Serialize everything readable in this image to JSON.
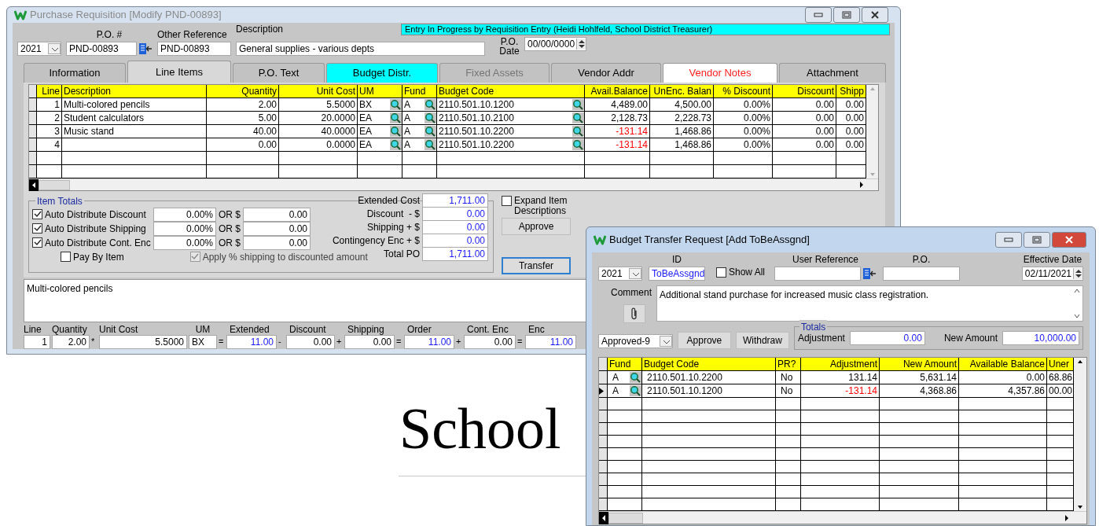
{
  "background": {
    "heading": "School"
  },
  "requisition_window": {
    "title": "Purchase Requisition [Modify PND-00893]",
    "status_banner": "Entry In Progress by Requisition Entry (Heidi Hohlfeld, School District Treasurer)",
    "year": "2021",
    "po_number": {
      "label": "P.O. #",
      "value": "PND-00893"
    },
    "other_reference": {
      "label": "Other Reference",
      "value": "PND-00893"
    },
    "description": {
      "label": "Description",
      "value": "General supplies - various depts"
    },
    "po_date": {
      "label": "P.O. Date",
      "value": "00/00/0000"
    },
    "tabs": [
      {
        "label": "Information",
        "selected": false,
        "disabled": false,
        "kind": "plain"
      },
      {
        "label": "Line Items",
        "selected": true,
        "disabled": false,
        "kind": "plain"
      },
      {
        "label": "P.O. Text",
        "selected": false,
        "disabled": false,
        "kind": "plain"
      },
      {
        "label": "Budget Distr.",
        "selected": false,
        "disabled": false,
        "kind": "highlighted"
      },
      {
        "label": "Fixed Assets",
        "selected": false,
        "disabled": true,
        "kind": "plain"
      },
      {
        "label": "Vendor Addr",
        "selected": false,
        "disabled": false,
        "kind": "plain"
      },
      {
        "label": "Vendor Notes",
        "selected": false,
        "disabled": false,
        "kind": "flagged"
      },
      {
        "label": "Attachment",
        "selected": false,
        "disabled": false,
        "kind": "plain"
      }
    ],
    "line_items": {
      "columns": [
        "Line",
        "Description",
        "Quantity",
        "Unit Cost",
        "UM",
        "Fund",
        "Budget Code",
        "Avail.Balance",
        "UnEnc. Balan",
        "% Discount",
        "Discount",
        "Shipp"
      ],
      "rows": [
        {
          "line": "1",
          "description": "Multi-colored pencils",
          "quantity": "2.00",
          "unit_cost": "5.5000",
          "um": "BX",
          "fund": "A",
          "budget_code": "2110.501.10.1200",
          "avail_balance": {
            "value": "4,489.00",
            "negative": false
          },
          "unenc_balance": "4,500.00",
          "pct_discount": "0.00%",
          "discount": "0.00",
          "shipping": "0.00"
        },
        {
          "line": "2",
          "description": "Student calculators",
          "quantity": "5.00",
          "unit_cost": "20.0000",
          "um": "EA",
          "fund": "A",
          "budget_code": "2110.501.10.2100",
          "avail_balance": {
            "value": "2,128.73",
            "negative": false
          },
          "unenc_balance": "2,228.73",
          "pct_discount": "0.00%",
          "discount": "0.00",
          "shipping": "0.00"
        },
        {
          "line": "3",
          "description": "Music stand",
          "quantity": "40.00",
          "unit_cost": "40.0000",
          "um": "EA",
          "fund": "A",
          "budget_code": "2110.501.10.2200",
          "avail_balance": {
            "value": "-131.14",
            "negative": true
          },
          "unenc_balance": "1,468.86",
          "pct_discount": "0.00%",
          "discount": "0.00",
          "shipping": "0.00"
        },
        {
          "line": "4",
          "quantity": "0.00",
          "unit_cost": "0.0000",
          "um": "EA",
          "fund": "A",
          "budget_code": "2110.501.10.2200",
          "avail_balance": {
            "value": "-131.14",
            "negative": true
          },
          "unenc_balance": "1,468.86",
          "pct_discount": "0.00%",
          "discount": "0.00",
          "shipping": "0.00"
        }
      ]
    },
    "item_totals": {
      "title": "Item Totals",
      "options": [
        {
          "label": "Auto Distribute Discount",
          "checked": true,
          "percent": "0.00%",
          "or_label": "OR $",
          "amount": "0.00"
        },
        {
          "label": "Auto Distribute Shipping",
          "checked": true,
          "percent": "0.00%",
          "or_label": "OR $",
          "amount": "0.00"
        },
        {
          "label": "Auto Distribute Cont. Enc",
          "checked": true,
          "percent": "0.00%",
          "or_label": "OR $",
          "amount": "0.00"
        }
      ],
      "pay_by_item": {
        "label": "Pay By Item",
        "checked": false
      },
      "apply_shipping": {
        "label": "Apply % shipping to discounted amount",
        "checked": true,
        "disabled": true
      },
      "totals": [
        {
          "label": "Extended Cost",
          "value": "1,711.00"
        },
        {
          "label": "Discount  - $",
          "value": "0.00"
        },
        {
          "label": "Shipping + $",
          "value": "0.00"
        },
        {
          "label": "Contingency Enc + $",
          "value": "0.00"
        },
        {
          "label": "Total PO",
          "value": "1,711.00"
        }
      ]
    },
    "expand_descriptions": {
      "label": "Expand Item Descriptions",
      "checked": false
    },
    "buttons": [
      {
        "label": "Approve",
        "focused": false
      },
      {
        "label": "Transfer",
        "focused": true
      }
    ],
    "item_notes": "Multi-colored pencils",
    "line_detail": [
      {
        "label": "Line",
        "value": "1",
        "computed": false
      },
      {
        "label": "Quantity",
        "value": "2.00",
        "computed": false,
        "operator": "*"
      },
      {
        "label": "Unit Cost",
        "value": "5.5000",
        "computed": false
      },
      {
        "label": "UM",
        "value": "BX",
        "computed": false,
        "operator": "="
      },
      {
        "label": "Extended",
        "value": "11.00",
        "computed": true,
        "operator": "-"
      },
      {
        "label": "Discount",
        "value": "0.00",
        "computed": false,
        "operator": "+"
      },
      {
        "label": "Shipping",
        "value": "0.00",
        "computed": false,
        "operator": "="
      },
      {
        "label": "Order",
        "value": "11.00",
        "computed": true,
        "operator": "+"
      },
      {
        "label": "Cont. Enc",
        "value": "0.00",
        "computed": false,
        "operator": "="
      },
      {
        "label": "Enc",
        "value": "11.00",
        "computed": true
      }
    ]
  },
  "transfer_window": {
    "title": "Budget Transfer Request [Add ToBeAssgnd]",
    "year": "2021",
    "id": {
      "label": "ID",
      "value": "ToBeAssgnd"
    },
    "show_all": {
      "label": "Show All",
      "checked": false
    },
    "user_reference": {
      "label": "User Reference"
    },
    "po": {
      "label": "P.O."
    },
    "effective_date": {
      "label": "Effective Date",
      "value": "02/11/2021"
    },
    "comment": {
      "label": "Comment",
      "value": "Additional stand purchase for increased music class registration."
    },
    "status": "Approved-9",
    "buttons": [
      "Approve",
      "Withdraw"
    ],
    "totals": {
      "title": "Totals",
      "adjustment": {
        "label": "Adjustment",
        "value": "0.00"
      },
      "new_amount": {
        "label": "New Amount",
        "value": "10,000.00"
      }
    },
    "table": {
      "columns": [
        "Fund",
        "Budget Code",
        "PR?",
        "Adjustment",
        "New Amount",
        "Available Balance",
        "Uner"
      ],
      "rows": [
        {
          "fund": "A",
          "budget_code": "2110.501.10.2200",
          "pr": "No",
          "adjustment": {
            "value": "131.14",
            "negative": false
          },
          "new_amount": "5,631.14",
          "available_balance": "0.00",
          "column_7": "68.86",
          "current": false
        },
        {
          "fund": "A",
          "budget_code": "2110.501.10.1200",
          "pr": "No",
          "adjustment": {
            "value": "-131.14",
            "negative": true
          },
          "new_amount": "4,368.86",
          "available_balance": "4,357.86",
          "column_7": "00.00",
          "current": true
        }
      ]
    }
  }
}
